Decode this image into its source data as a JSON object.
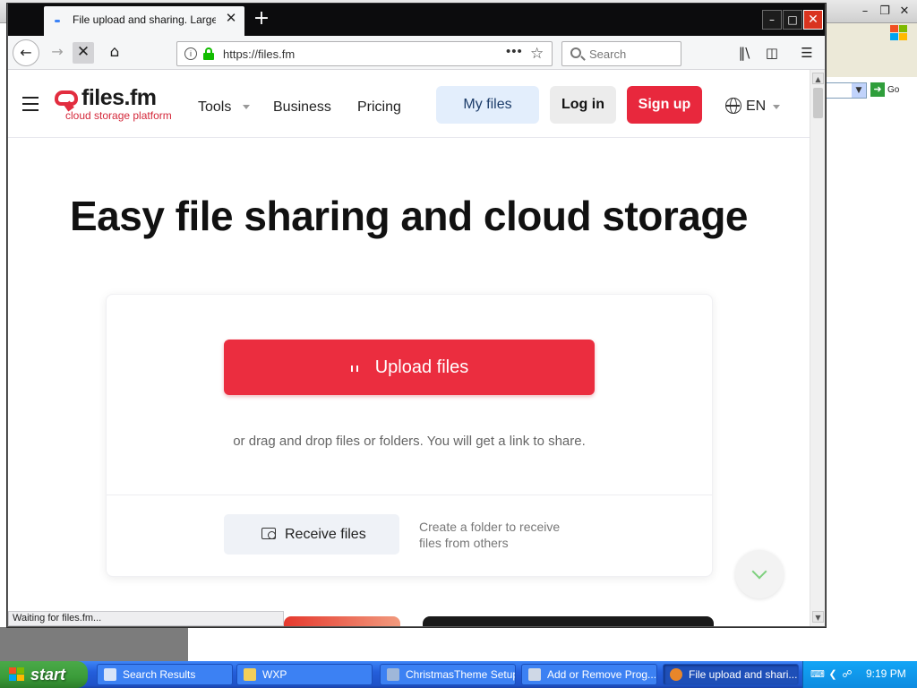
{
  "desktop": {
    "go_label": "Go"
  },
  "browser": {
    "tab_title": "File upload and sharing. Large file s",
    "url": "https://files.fm",
    "search_placeholder": "Search",
    "status_text": "Waiting for files.fm..."
  },
  "site": {
    "logo_name": "files.fm",
    "logo_tagline": "cloud storage platform",
    "nav": [
      "Tools",
      "Business",
      "Pricing"
    ],
    "my_files": "My files",
    "login": "Log in",
    "signup": "Sign up",
    "language": "EN",
    "hero_title": "Easy file sharing and cloud storage",
    "upload_label": "Upload files",
    "drag_text": "or drag and drop files or folders. You will get a link to share.",
    "receive_label": "Receive files",
    "receive_desc": "Create a folder to receive files from others",
    "brand_color": "#e8283d"
  },
  "taskbar": {
    "start_label": "start",
    "items": [
      {
        "label": "Search Results",
        "icon": "search-results-icon"
      },
      {
        "label": "WXP",
        "icon": "folder-icon"
      },
      {
        "label": "ChristmasTheme Setup",
        "icon": "setup-icon"
      },
      {
        "label": "Add or Remove Prog...",
        "icon": "add-remove-icon"
      },
      {
        "label": "File upload and shari...",
        "icon": "firefox-icon"
      }
    ],
    "clock": "9:19 PM"
  }
}
